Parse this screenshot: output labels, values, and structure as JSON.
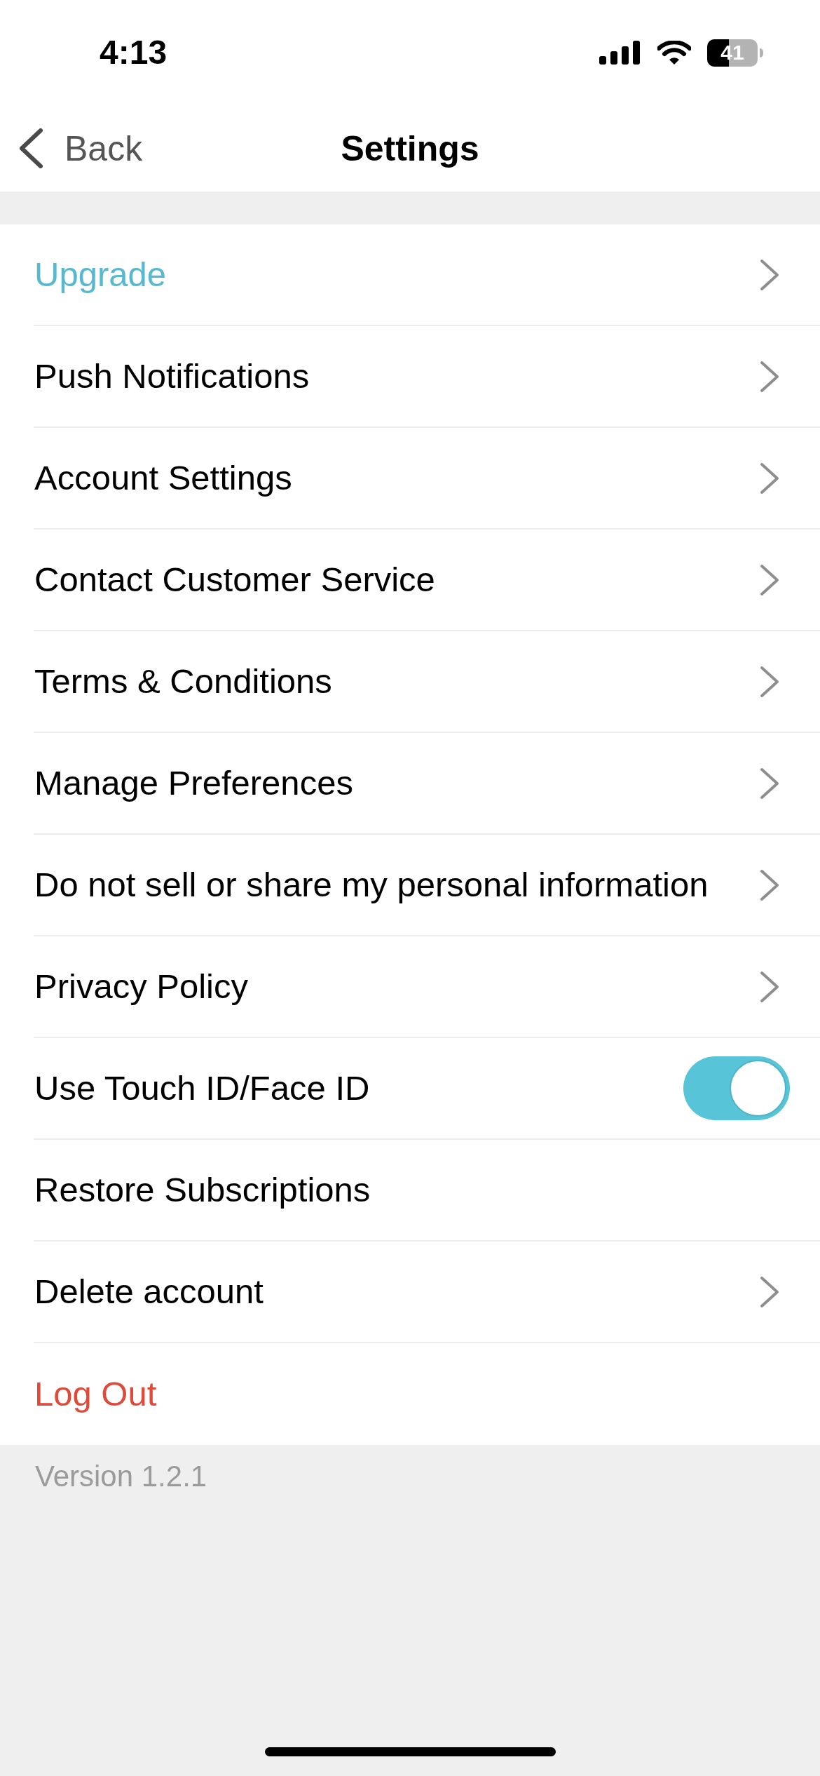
{
  "status_bar": {
    "time": "4:13",
    "battery": "41"
  },
  "nav": {
    "back": "Back",
    "title": "Settings"
  },
  "items": [
    {
      "label": "Upgrade",
      "kind": "chevron",
      "color": "#58b8cf"
    },
    {
      "label": "Push Notifications",
      "kind": "chevron",
      "color": "#000000"
    },
    {
      "label": "Account Settings",
      "kind": "chevron",
      "color": "#000000"
    },
    {
      "label": "Contact Customer Service",
      "kind": "chevron",
      "color": "#000000"
    },
    {
      "label": "Terms & Conditions",
      "kind": "chevron",
      "color": "#000000"
    },
    {
      "label": "Manage Preferences",
      "kind": "chevron",
      "color": "#000000"
    },
    {
      "label": "Do not sell or share my personal information",
      "kind": "chevron",
      "color": "#000000"
    },
    {
      "label": "Privacy Policy",
      "kind": "chevron",
      "color": "#000000"
    },
    {
      "label": "Use Touch ID/Face ID",
      "kind": "toggle",
      "on": true,
      "color": "#000000"
    },
    {
      "label": "Restore Subscriptions",
      "kind": "plain",
      "color": "#000000"
    },
    {
      "label": "Delete account",
      "kind": "chevron",
      "color": "#000000"
    },
    {
      "label": "Log Out",
      "kind": "plain",
      "color": "#e04a3b"
    }
  ],
  "footer": {
    "version": "Version 1.2.1"
  }
}
